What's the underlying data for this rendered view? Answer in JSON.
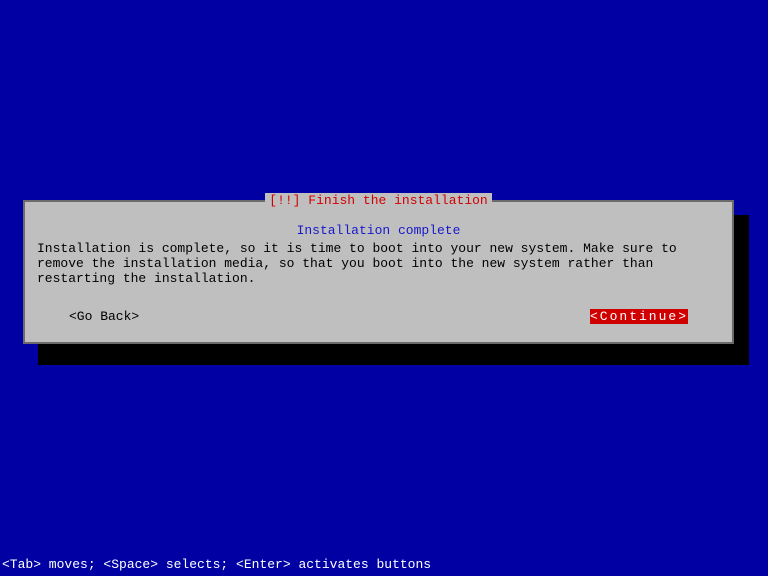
{
  "dialog": {
    "title": "[!!] Finish the installation",
    "subtitle": "Installation complete",
    "body": "Installation is complete, so it is time to boot into your new system. Make sure to remove the installation media, so that you boot into the new system rather than restarting the installation.",
    "go_back_label": "<Go Back>",
    "continue_label": "<Continue>"
  },
  "helpbar": "<Tab> moves; <Space> selects; <Enter> activates buttons"
}
